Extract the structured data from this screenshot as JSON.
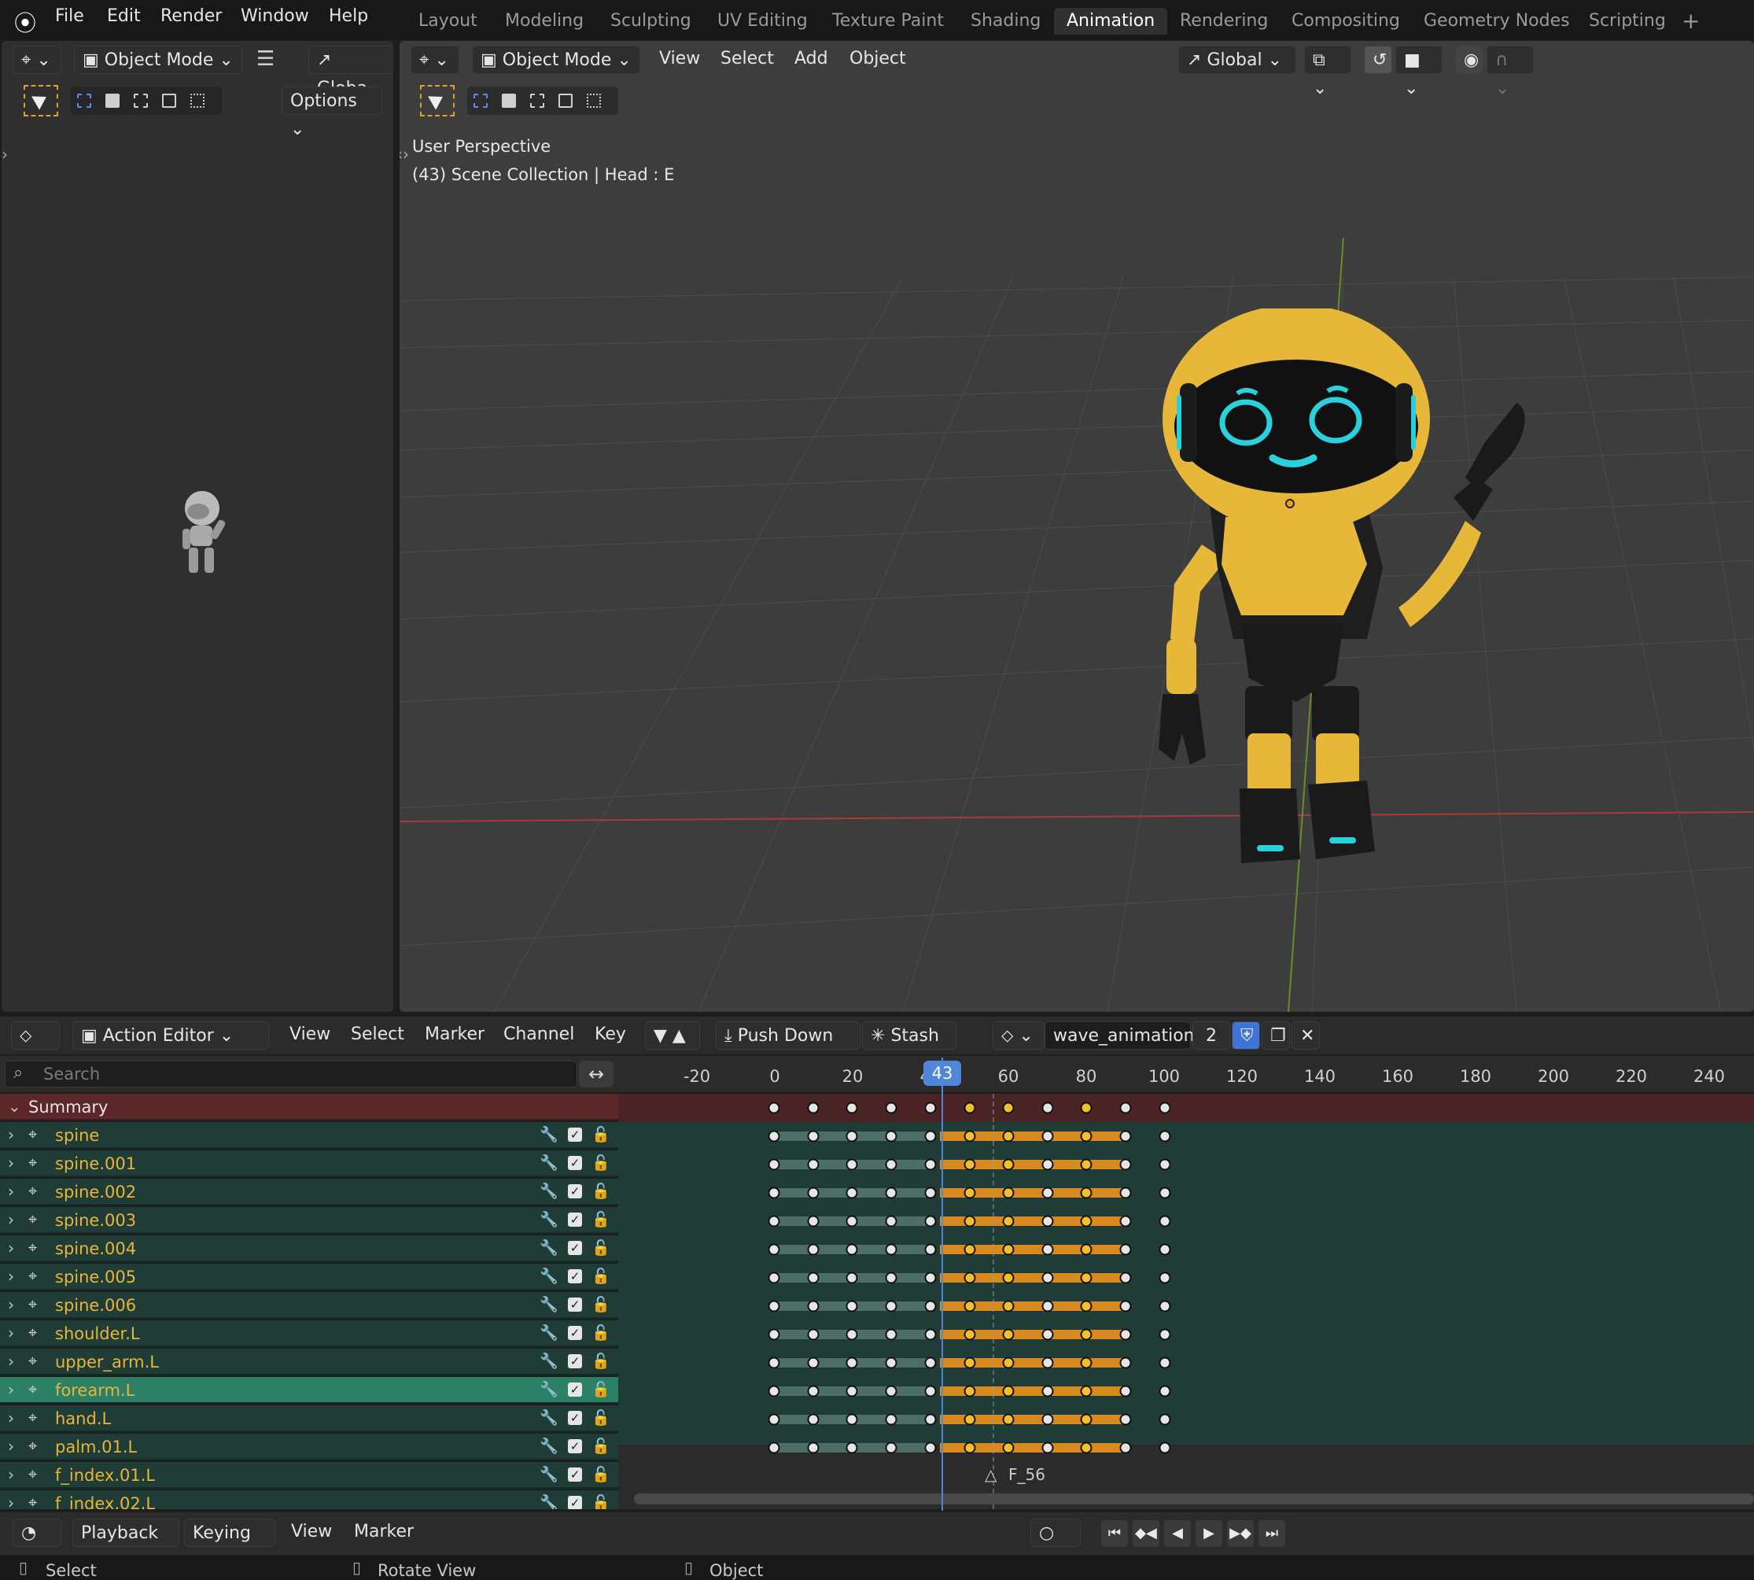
{
  "menu": [
    "File",
    "Edit",
    "Render",
    "Window",
    "Help"
  ],
  "workspaces": [
    "Layout",
    "Modeling",
    "Sculpting",
    "UV Editing",
    "Texture Paint",
    "Shading",
    "Animation",
    "Rendering",
    "Compositing",
    "Geometry Nodes",
    "Scripting"
  ],
  "active_workspace": "Animation",
  "add_workspace_icon": "plus-icon",
  "left_view": {
    "mode": "Object Mode",
    "transform": "Globa",
    "options": "Options"
  },
  "viewport": {
    "mode": "Object Mode",
    "menus": [
      "View",
      "Select",
      "Add",
      "Object"
    ],
    "transform": "Global",
    "info_line1": "User Perspective",
    "info_line2": "(43) Scene Collection | Head : E"
  },
  "action_editor": {
    "mode": "Action Editor",
    "menus": [
      "View",
      "Select",
      "Marker",
      "Channel",
      "Key"
    ],
    "push_down": "Push Down",
    "stash": "Stash",
    "action_name": "wave_animation",
    "users": "2",
    "search_placeholder": "Search",
    "ticks": [
      "-20",
      "0",
      "20",
      "40",
      "60",
      "80",
      "100",
      "120",
      "140",
      "160",
      "180",
      "200",
      "220",
      "240"
    ],
    "current_frame": "43",
    "marker_label": "F_56",
    "channels": [
      "Summary",
      "spine",
      "spine.001",
      "spine.002",
      "spine.003",
      "spine.004",
      "spine.005",
      "spine.006",
      "shoulder.L",
      "upper_arm.L",
      "forearm.L",
      "hand.L",
      "palm.01.L",
      "f_index.01.L",
      "f_index.02.L"
    ],
    "selected_channel": "forearm.L"
  },
  "playback_bar": {
    "playback": "Playback",
    "keying": "Keying",
    "view": "View",
    "marker": "Marker"
  },
  "status_bar": [
    "Select",
    "Rotate View",
    "Object"
  ]
}
